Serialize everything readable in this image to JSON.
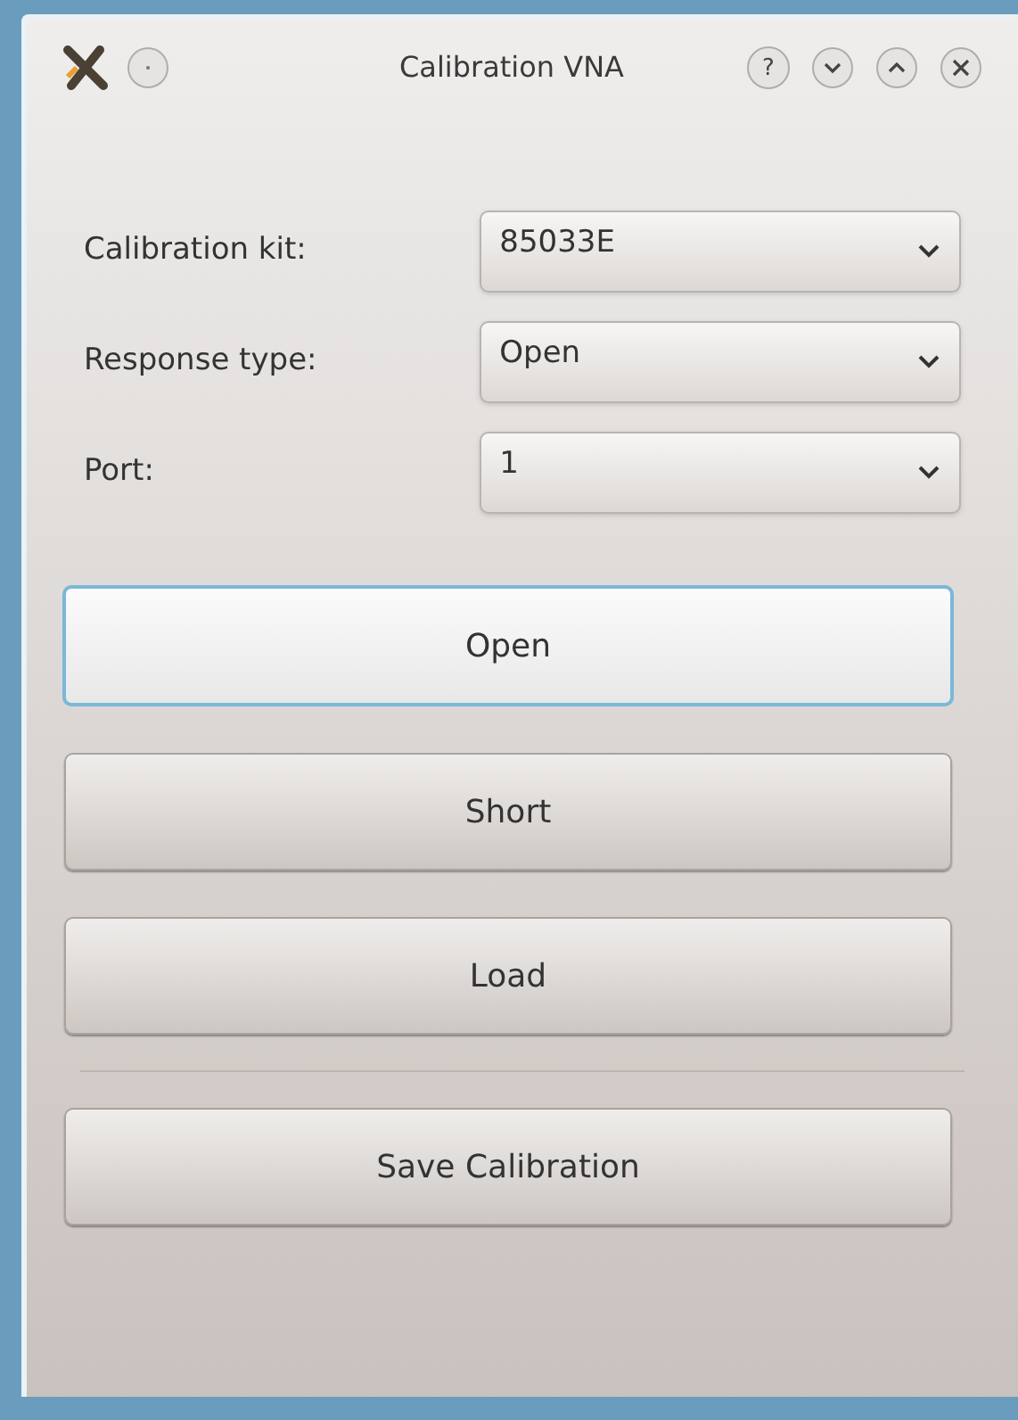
{
  "window": {
    "title": "Calibration VNA",
    "title_buttons": [
      {
        "kind": "help",
        "label": "?"
      },
      {
        "kind": "minimize"
      },
      {
        "kind": "maximize"
      },
      {
        "kind": "close"
      }
    ]
  },
  "fields": [
    {
      "label": "Calibration kit:",
      "value": "85033E"
    },
    {
      "label": "Response type:",
      "value": "Open"
    },
    {
      "label": "Port:",
      "value": "1"
    }
  ],
  "buttons": [
    {
      "label": "Open",
      "focused": true,
      "separator_before": false
    },
    {
      "label": "Short",
      "focused": false,
      "separator_before": false
    },
    {
      "label": "Load",
      "focused": false,
      "separator_before": false
    },
    {
      "label": "Save Calibration",
      "focused": false,
      "separator_before": true
    }
  ]
}
